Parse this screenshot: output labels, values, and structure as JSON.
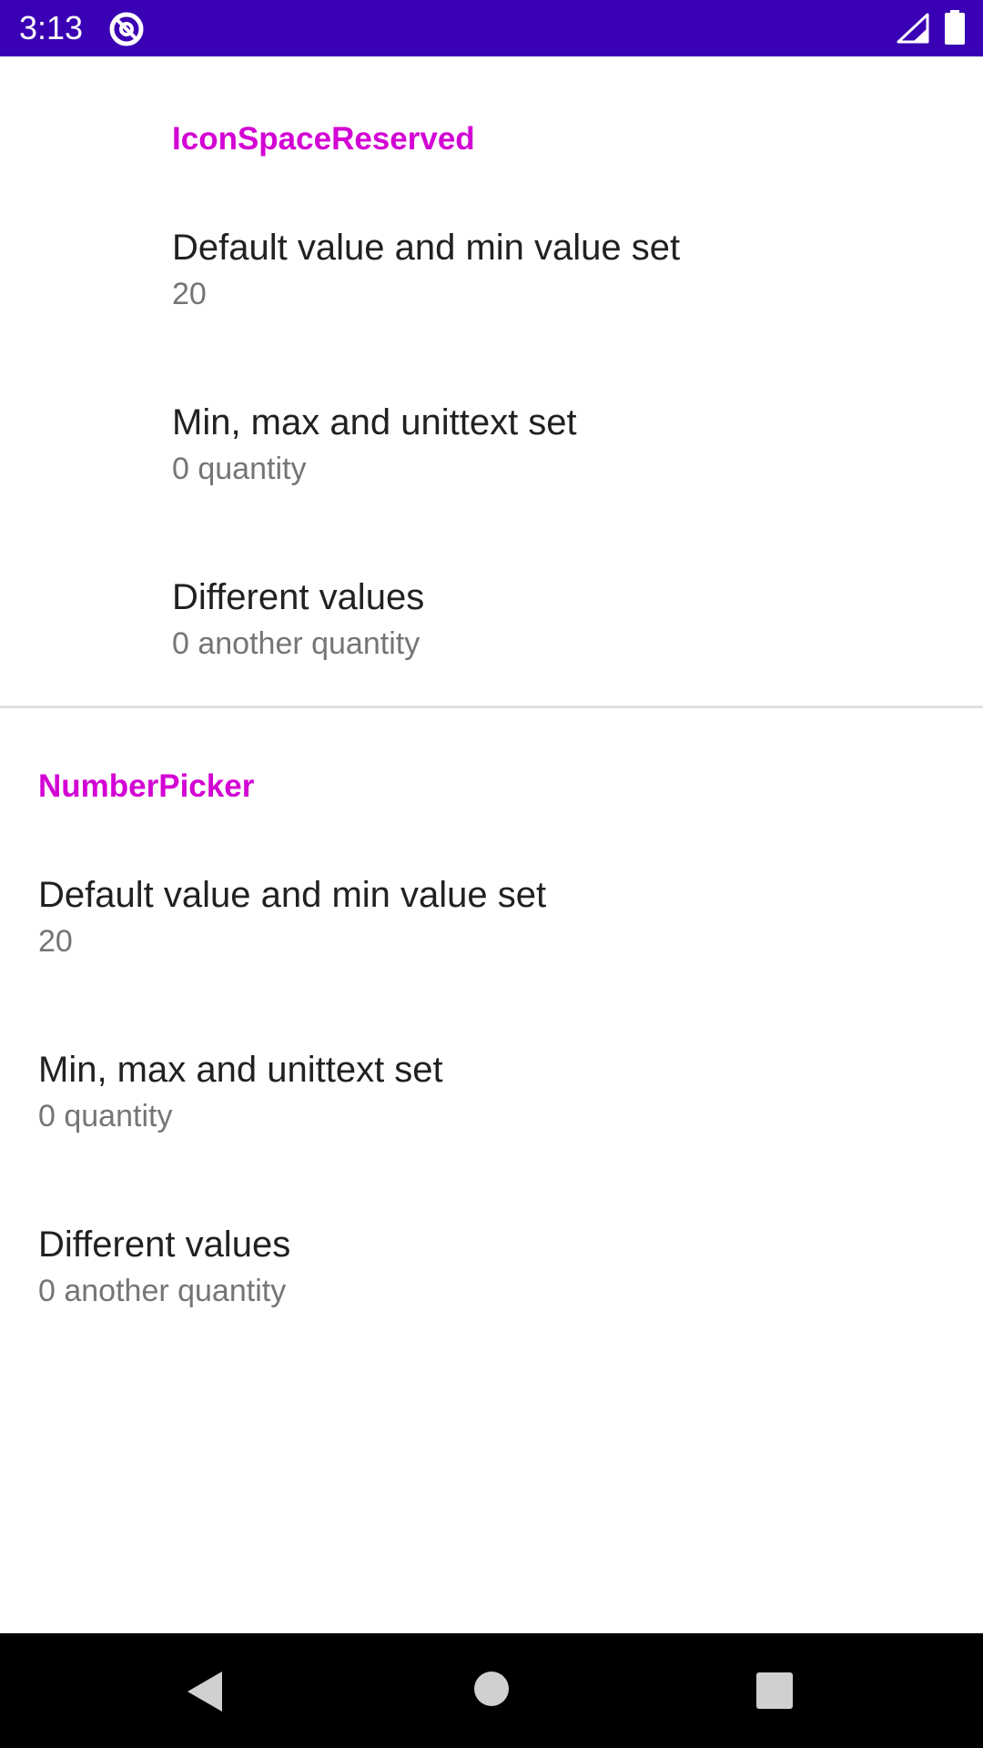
{
  "status_bar": {
    "time": "3:13",
    "background_color": "#3a00b4",
    "icons": [
      "app-notification-icon",
      "cell-signal-icon",
      "battery-icon"
    ]
  },
  "accent_color": "#d300d3",
  "sections": [
    {
      "title": "IconSpaceReserved",
      "items": [
        {
          "title": "Default value and min value set",
          "summary": "20"
        },
        {
          "title": "Min, max and unittext set",
          "summary": "0 quantity"
        },
        {
          "title": "Different values",
          "summary": "0 another quantity"
        }
      ]
    },
    {
      "title": "NumberPicker",
      "items": [
        {
          "title": "Default value and min value set",
          "summary": "20"
        },
        {
          "title": "Min, max and unittext set",
          "summary": "0 quantity"
        },
        {
          "title": "Different values",
          "summary": "0 another quantity"
        }
      ]
    }
  ],
  "nav_bar": {
    "icons": [
      "back-icon",
      "home-icon",
      "recents-icon"
    ]
  }
}
